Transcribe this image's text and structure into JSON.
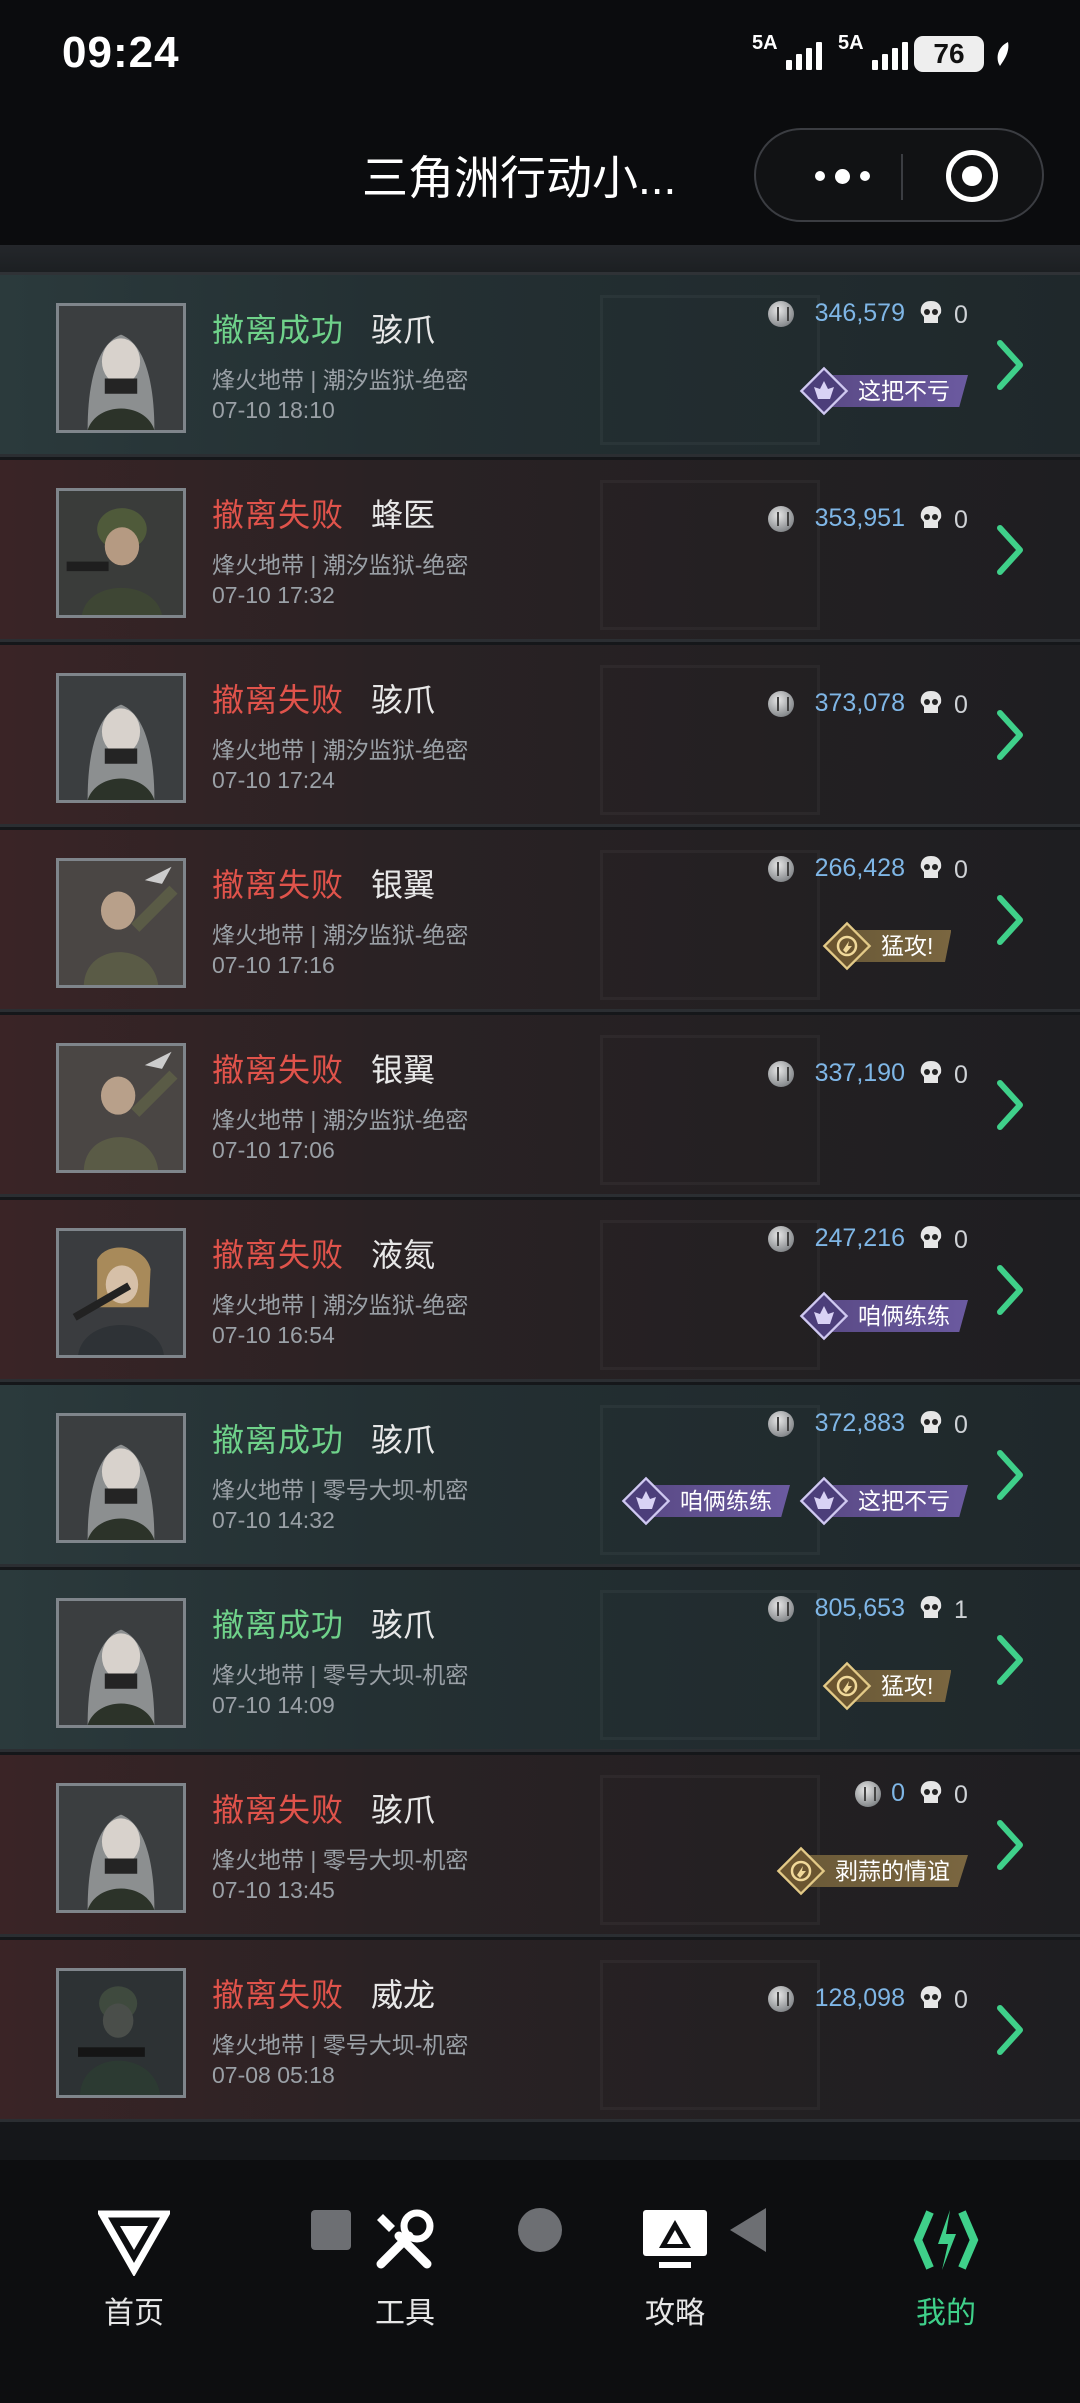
{
  "status_bar": {
    "time": "09:24",
    "sim1": "5A",
    "sim2": "5A",
    "battery": "76"
  },
  "header": {
    "title": "三角洲行动小..."
  },
  "records": [
    {
      "result": "撤离成功",
      "success": true,
      "operator": "骇爪",
      "map": "烽火地带 | 潮汐监狱-绝密",
      "time": "07-10 18:10",
      "value": "346,579",
      "kills": "0",
      "badges": [
        {
          "type": "purple",
          "text": "这把不亏"
        }
      ],
      "portrait": "hood"
    },
    {
      "result": "撤离失败",
      "success": false,
      "operator": "蜂医",
      "map": "烽火地带 | 潮汐监狱-绝密",
      "time": "07-10 17:32",
      "value": "353,951",
      "kills": "0",
      "badges": [],
      "portrait": "helmet"
    },
    {
      "result": "撤离失败",
      "success": false,
      "operator": "骇爪",
      "map": "烽火地带 | 潮汐监狱-绝密",
      "time": "07-10 17:24",
      "value": "373,078",
      "kills": "0",
      "badges": [],
      "portrait": "hood"
    },
    {
      "result": "撤离失败",
      "success": false,
      "operator": "银翼",
      "map": "烽火地带 | 潮汐监狱-绝密",
      "time": "07-10 17:16",
      "value": "266,428",
      "kills": "0",
      "badges": [
        {
          "type": "gold",
          "text": "猛攻!"
        }
      ],
      "portrait": "bird"
    },
    {
      "result": "撤离失败",
      "success": false,
      "operator": "银翼",
      "map": "烽火地带 | 潮汐监狱-绝密",
      "time": "07-10 17:06",
      "value": "337,190",
      "kills": "0",
      "badges": [],
      "portrait": "bird"
    },
    {
      "result": "撤离失败",
      "success": false,
      "operator": "液氮",
      "map": "烽火地带 | 潮汐监狱-绝密",
      "time": "07-10 16:54",
      "value": "247,216",
      "kills": "0",
      "badges": [
        {
          "type": "purple",
          "text": "咱俩练练"
        }
      ],
      "portrait": "hair"
    },
    {
      "result": "撤离成功",
      "success": true,
      "operator": "骇爪",
      "map": "烽火地带 | 零号大坝-机密",
      "time": "07-10 14:32",
      "value": "372,883",
      "kills": "0",
      "badges": [
        {
          "type": "purple",
          "text": "咱俩练练"
        },
        {
          "type": "purple",
          "text": "这把不亏"
        }
      ],
      "portrait": "hood"
    },
    {
      "result": "撤离成功",
      "success": true,
      "operator": "骇爪",
      "map": "烽火地带 | 零号大坝-机密",
      "time": "07-10 14:09",
      "value": "805,653",
      "kills": "1",
      "badges": [
        {
          "type": "gold",
          "text": "猛攻!"
        }
      ],
      "portrait": "hood"
    },
    {
      "result": "撤离失败",
      "success": false,
      "operator": "骇爪",
      "map": "烽火地带 | 零号大坝-机密",
      "time": "07-10 13:45",
      "value": "0",
      "kills": "0",
      "badges": [
        {
          "type": "gold",
          "text": "剥蒜的情谊"
        }
      ],
      "portrait": "hood"
    },
    {
      "result": "撤离失败",
      "success": false,
      "operator": "威龙",
      "map": "烽火地带 | 零号大坝-机密",
      "time": "07-08 05:18",
      "value": "128,098",
      "kills": "0",
      "badges": [],
      "portrait": "armor"
    }
  ],
  "bottom_nav": [
    {
      "label": "首页",
      "icon": "delta-logo-icon",
      "active": false
    },
    {
      "label": "工具",
      "icon": "tools-icon",
      "active": false
    },
    {
      "label": "攻略",
      "icon": "guide-monitor-icon",
      "active": false
    },
    {
      "label": "我的",
      "icon": "profile-logo-icon",
      "active": true
    }
  ],
  "colors": {
    "success": "#6fd28a",
    "fail": "#e0534b",
    "value": "#7fb6e6",
    "active_nav": "#3fd08a"
  }
}
